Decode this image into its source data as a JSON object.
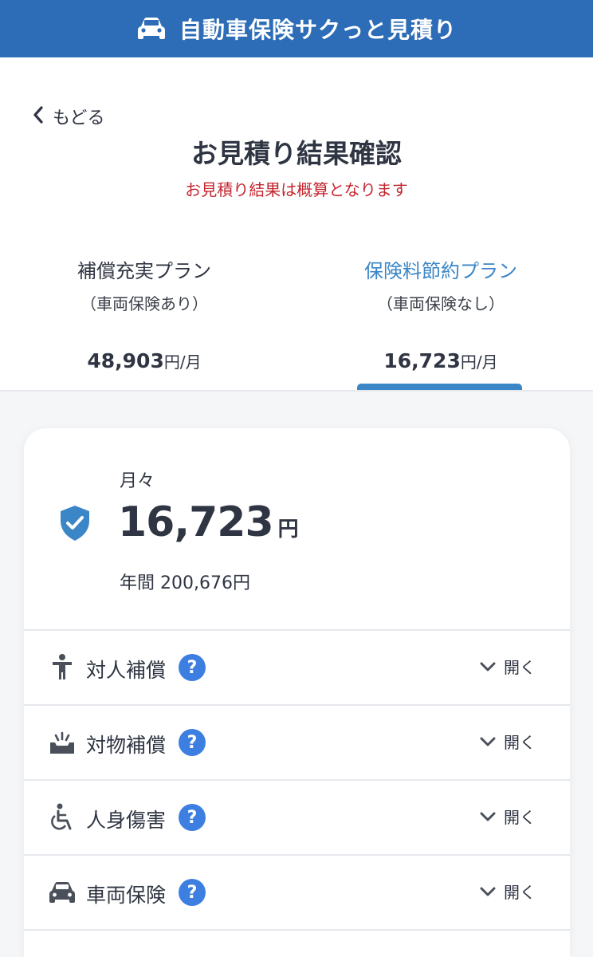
{
  "header": {
    "title": "自動車保険サクっと見積り",
    "icon": "car-icon"
  },
  "nav": {
    "back_label": "もどる",
    "back_icon": "chevron-left-icon"
  },
  "page": {
    "title": "お見積り結果確認",
    "notice": "お見積り結果は概算となります",
    "notice_color": "#c3262f"
  },
  "plans": [
    {
      "name": "補償充実プラン",
      "sub": "（車両保険あり）",
      "price": "48,903",
      "unit": "円/月",
      "selected": false
    },
    {
      "name": "保険料節約プラン",
      "sub": "（車両保険なし）",
      "price": "16,723",
      "unit": "円/月",
      "selected": true
    }
  ],
  "summary": {
    "monthly_label": "月々",
    "monthly_amount": "16,723",
    "currency": "円",
    "annual_text": "年間 200,676円",
    "icon": "shield-check-icon"
  },
  "coverages": [
    {
      "label": "対人補償",
      "icon": "person-icon",
      "help": "?",
      "toggle": "開く"
    },
    {
      "label": "対物補償",
      "icon": "collision-icon",
      "help": "?",
      "toggle": "開く"
    },
    {
      "label": "人身傷害",
      "icon": "wheelchair-icon",
      "help": "?",
      "toggle": "開く"
    },
    {
      "label": "車両保険",
      "icon": "car-icon",
      "help": "?",
      "toggle": "開く"
    }
  ],
  "colors": {
    "header_bg": "#2d6cb6",
    "accent": "#3b86c6",
    "help_badge": "#3d7fe0",
    "text": "#2f3542"
  }
}
